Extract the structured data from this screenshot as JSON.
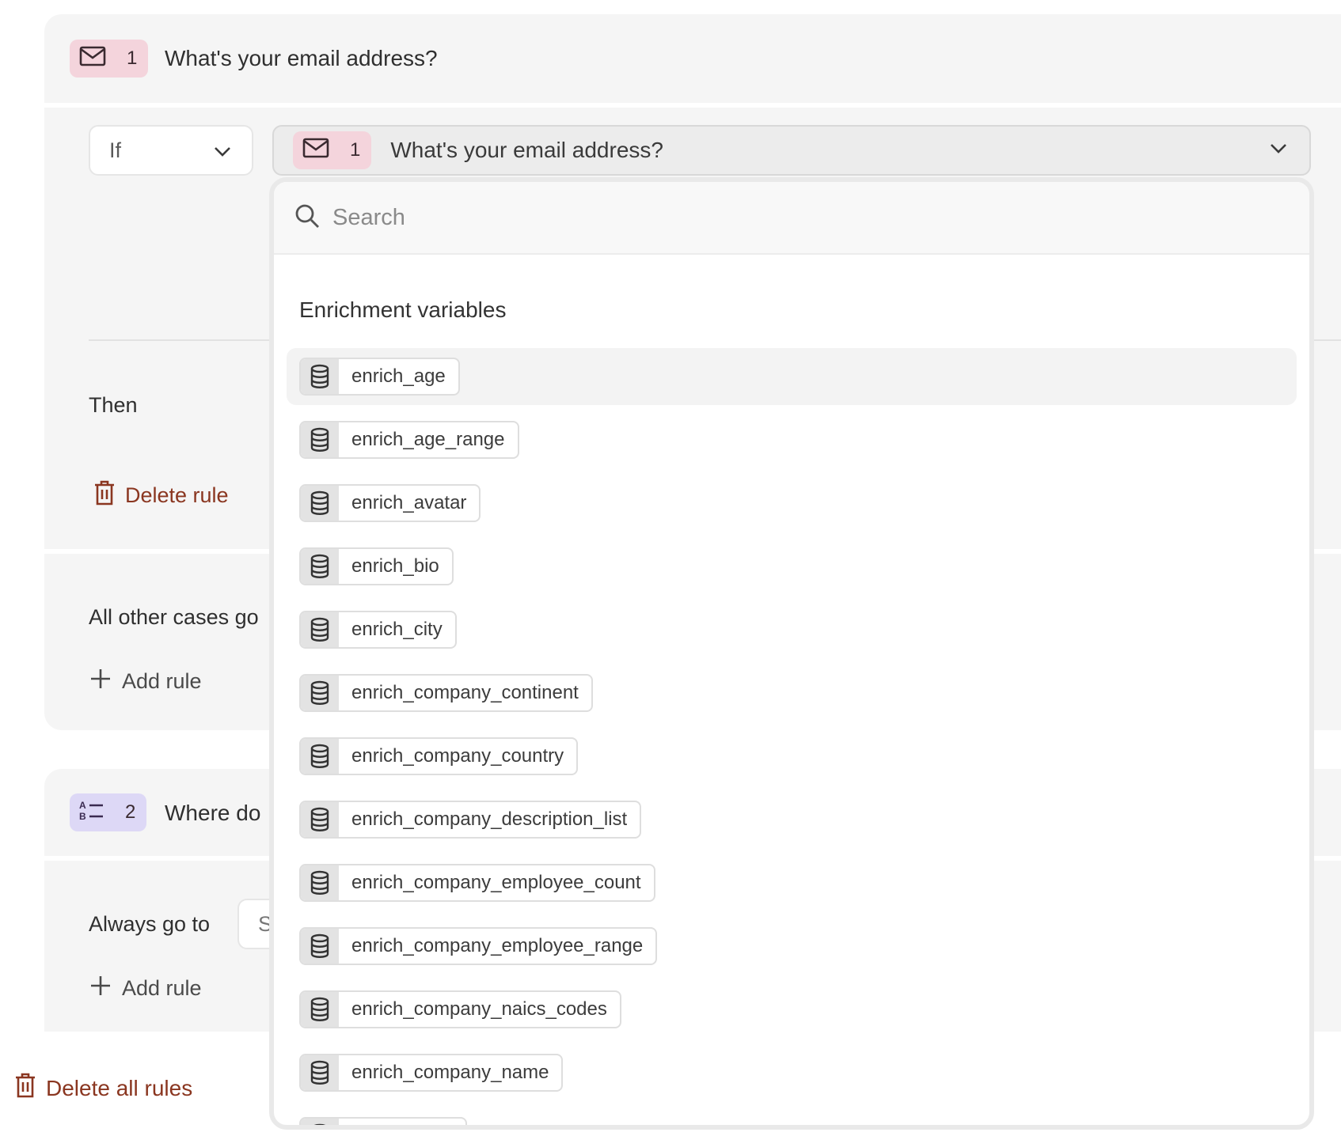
{
  "question1": {
    "number": "1",
    "title": "What's your email address?",
    "icon": "envelope-icon"
  },
  "rule": {
    "condition_label": "If",
    "selected_question": {
      "number": "1",
      "title": "What's your email address?"
    },
    "then_label": "Then",
    "delete_rule_label": "Delete rule"
  },
  "other_cases": {
    "label": "All other cases go",
    "add_rule_label": "Add rule"
  },
  "question2": {
    "number": "2",
    "title": "Where do",
    "icon": "multiple-choice-icon",
    "always_label": "Always go to",
    "select_value": "S",
    "add_rule_label": "Add rule"
  },
  "delete_all_label": "Delete all rules",
  "dropdown": {
    "search_placeholder": "Search",
    "section_heading": "Enrichment variables",
    "items": [
      {
        "label": "enrich_age"
      },
      {
        "label": "enrich_age_range"
      },
      {
        "label": "enrich_avatar"
      },
      {
        "label": "enrich_bio"
      },
      {
        "label": "enrich_city"
      },
      {
        "label": "enrich_company_continent"
      },
      {
        "label": "enrich_company_country"
      },
      {
        "label": "enrich_company_description_list"
      },
      {
        "label": "enrich_company_employee_count"
      },
      {
        "label": "enrich_company_employee_range"
      },
      {
        "label": "enrich_company_naics_codes"
      },
      {
        "label": "enrich_company_name"
      },
      {
        "label": ""
      }
    ],
    "item_icon": "database-icon"
  },
  "colors": {
    "accent_red": "#8a3620",
    "pink_badge": "#f4d4dc",
    "violet_badge": "#ddd8f6"
  }
}
